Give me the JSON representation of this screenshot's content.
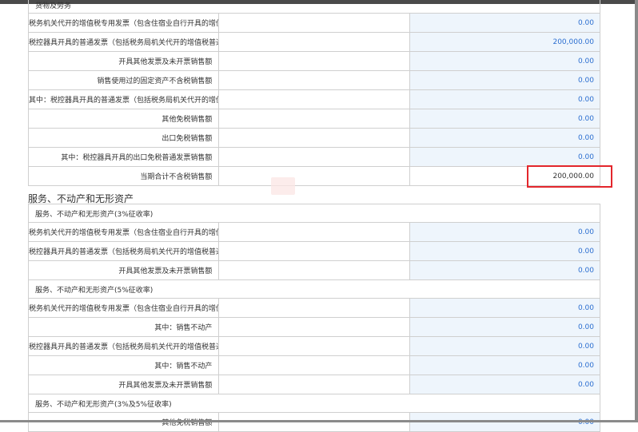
{
  "goods": {
    "header": "货物及劳务",
    "rows": [
      {
        "label": "税务机关代开的增值税专用发票（包含住宿业自行开具的增值税专用发票）不含税销售额",
        "value": "0.00"
      },
      {
        "label": "税控器具开具的普通发票（包括税务局机关代开的增值税普通发票）不含税销售额",
        "value": "200,000.00"
      },
      {
        "label": "开具其他发票及未开票销售额",
        "value": "0.00"
      },
      {
        "label": "销售使用过的固定资产不含税销售额",
        "value": "0.00"
      },
      {
        "label": "其中：税控器具开具的普通发票（包括税务局机关代开的增值税普通发票）不含税销售额",
        "value": "0.00"
      },
      {
        "label": "其他免税销售额",
        "value": "0.00"
      },
      {
        "label": "出口免税销售额",
        "value": "0.00"
      },
      {
        "label": "其中：税控器具开具的出口免税普通发票销售额",
        "value": "0.00"
      }
    ],
    "total": {
      "label": "当期合计不含税销售额",
      "value": "200,000.00"
    }
  },
  "services": {
    "title": "服务、不动产和无形资产",
    "group3": {
      "header": "服务、不动产和无形资产(3%征收率)",
      "rows": [
        {
          "label": "税务机关代开的增值税专用发票（包含住宿业自行开具的增值税专用发票）不含税销售额",
          "value": "0.00"
        },
        {
          "label": "税控器具开具的普通发票（包括税务局机关代开的增值税普通发票）不含税销售额",
          "value": "0.00"
        },
        {
          "label": "开具其他发票及未开票销售额",
          "value": "0.00"
        }
      ]
    },
    "group5": {
      "header": "服务、不动产和无形资产(5%征收率)",
      "rows": [
        {
          "label": "税务机关代开的增值税专用发票（包含住宿业自行开具的增值税专用发票）不含税销售额",
          "value": "0.00"
        },
        {
          "label": "其中：销售不动产",
          "value": "0.00"
        },
        {
          "label": "税控器具开具的普通发票（包括税务局机关代开的增值税普通发票）不含税销售额",
          "value": "0.00"
        },
        {
          "label": "其中：销售不动产",
          "value": "0.00"
        },
        {
          "label": "开具其他发票及未开票销售额",
          "value": "0.00"
        }
      ]
    },
    "group35": {
      "header": "服务、不动产和无形资产(3%及5%征收率)",
      "rows": [
        {
          "label": "其他免税销售额",
          "value": "0.00"
        }
      ]
    }
  },
  "colors": {
    "highlight": "#e3262c",
    "editable_bg": "#eef5fc",
    "value_text": "#2b6ed0"
  }
}
